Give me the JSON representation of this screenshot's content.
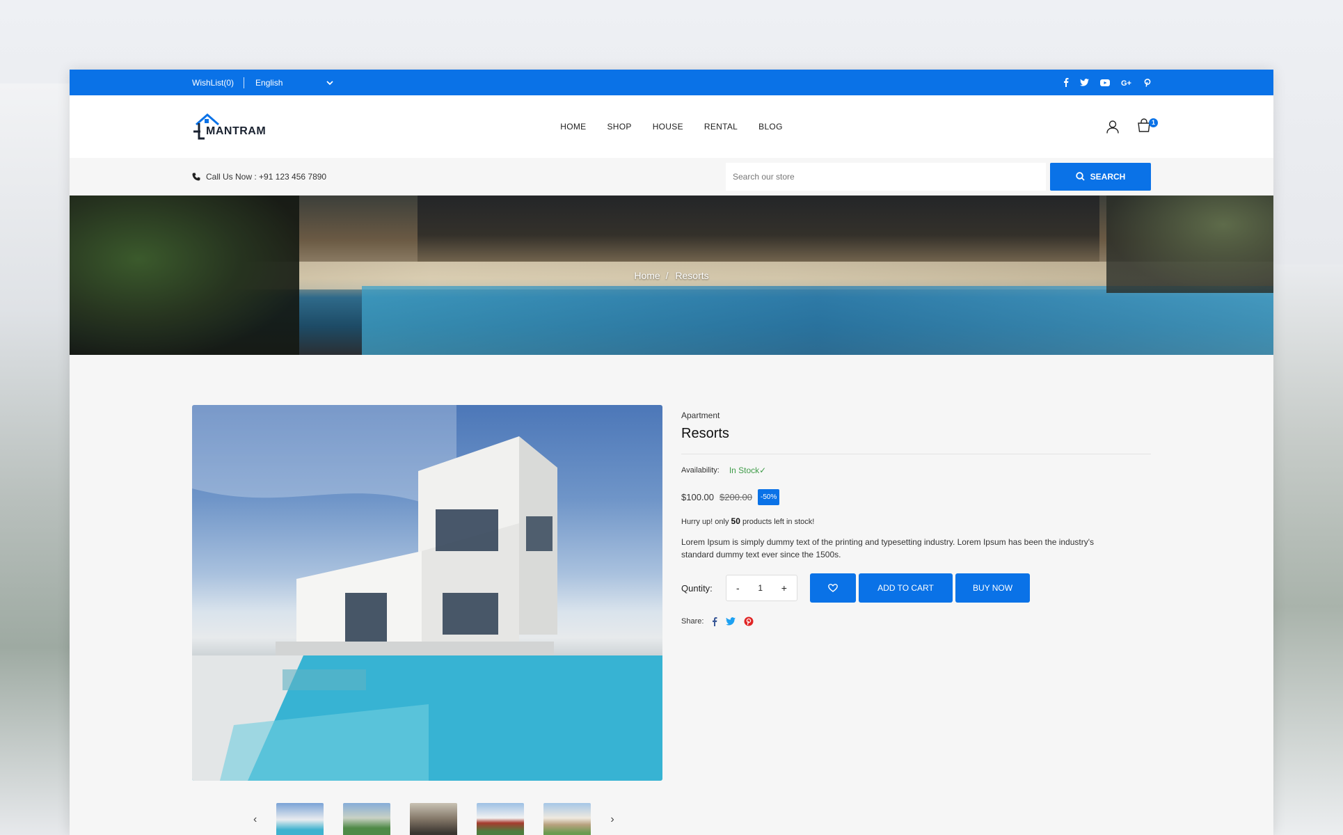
{
  "topbar": {
    "wishlist": "WishList(0)",
    "language": "English",
    "social_icons": [
      "facebook-icon",
      "twitter-icon",
      "youtube-icon",
      "google-plus-icon",
      "pinterest-icon"
    ]
  },
  "header": {
    "logo_text": "MANTRAM",
    "nav": [
      "HOME",
      "SHOP",
      "HOUSE",
      "RENTAL",
      "BLOG"
    ],
    "cart_count": "1"
  },
  "subbar": {
    "call_text": "Call Us Now : +91 123 456 7890",
    "search_placeholder": "Search our store",
    "search_button": "SEARCH"
  },
  "banner": {
    "breadcrumb_home": "Home",
    "breadcrumb_sep": "/",
    "breadcrumb_current": "Resorts"
  },
  "product": {
    "category": "Apartment",
    "title": "Resorts",
    "availability_label": "Availability:",
    "availability_value": "In Stock✓",
    "price": "$100.00",
    "old_price": "$200.00",
    "discount": "-50%",
    "hurry_prefix": "Hurry up! only",
    "hurry_count": "50",
    "hurry_suffix": "products left in stock!",
    "description": "Lorem Ipsum is simply dummy text of the printing and typesetting industry. Lorem Ipsum has been the industry's standard dummy text ever since the 1500s.",
    "quantity_label": "Quntity:",
    "quantity_value": "1",
    "minus": "-",
    "plus": "+",
    "add_to_cart": "ADD TO CART",
    "buy_now": "BUY NOW",
    "share_label": "Share:"
  },
  "colors": {
    "primary": "#0a72e7",
    "in_stock": "#3f9c49"
  }
}
